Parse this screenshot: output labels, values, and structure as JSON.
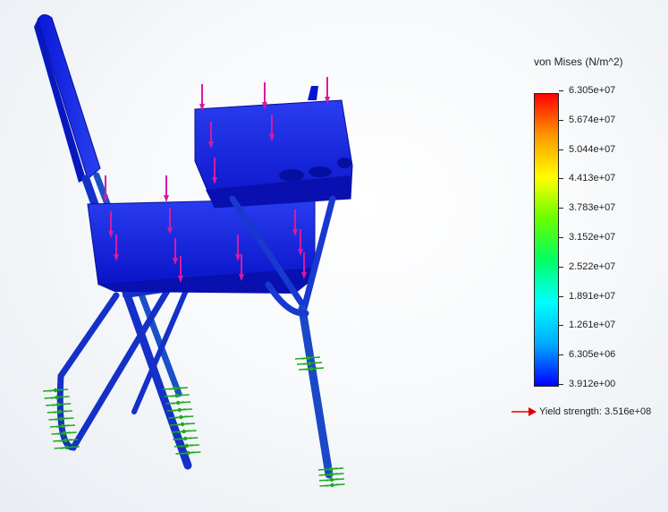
{
  "legend": {
    "title": "von Mises (N/m^2)",
    "colormap": [
      "#0000ff",
      "#00aaff",
      "#00ffff",
      "#00ff66",
      "#66ff00",
      "#ffff00",
      "#ff9900",
      "#ff0000"
    ],
    "ticks": [
      "6.305e+07",
      "5.674e+07",
      "5.044e+07",
      "4.413e+07",
      "3.783e+07",
      "3.152e+07",
      "2.522e+07",
      "1.891e+07",
      "1.261e+07",
      "6.305e+06",
      "3.912e+00"
    ]
  },
  "yield": {
    "label": "Yield strength: 3.516e+08",
    "arrow_color": "#e00000"
  },
  "model": {
    "body_color": "#0a14e0",
    "load_arrow_color": "#d81aa0",
    "fixture_color": "#1fa81f"
  }
}
